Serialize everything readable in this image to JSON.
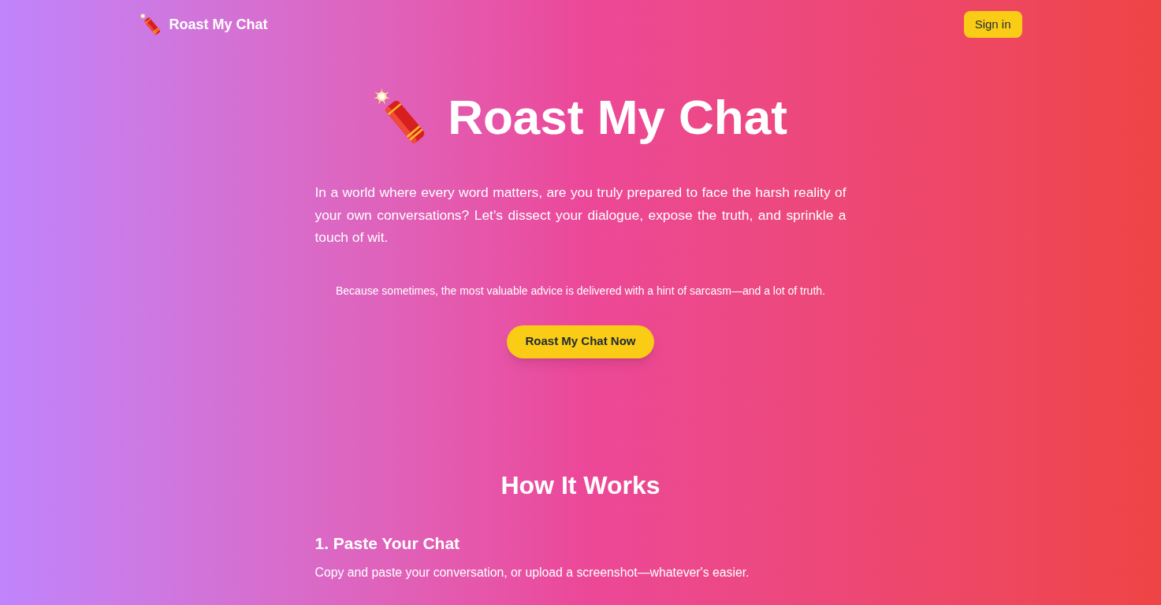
{
  "nav": {
    "logo": "Roast My Chat",
    "sign_in": "Sign in"
  },
  "hero": {
    "title": "Roast My Chat",
    "intro": "In a world where every word matters, are you truly prepared to face the harsh reality of your own conversations? Let's dissect your dialogue, expose the truth, and sprinkle a touch of wit.",
    "tagline": "Because sometimes, the most valuable advice is delivered with a hint of sarcasm—and a lot of truth.",
    "cta": "Roast My Chat Now"
  },
  "how_it_works": {
    "heading": "How It Works",
    "steps": [
      {
        "title": "1. Paste Your Chat",
        "description": "Copy and paste your conversation, or upload a screenshot—whatever's easier."
      }
    ]
  }
}
